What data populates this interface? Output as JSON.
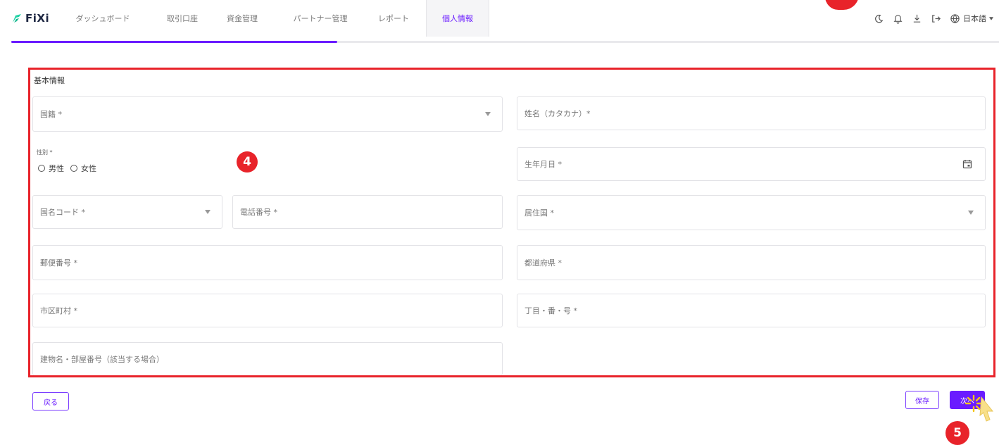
{
  "app": {
    "logo_text": "FiXi"
  },
  "nav": {
    "tabs": [
      {
        "label": "ダッシュボード"
      },
      {
        "label": "取引口座"
      },
      {
        "label": "資金管理"
      },
      {
        "label": "パートナー管理"
      },
      {
        "label": "レポート"
      },
      {
        "label": "個人情報",
        "active": true
      }
    ]
  },
  "header_right": {
    "icons": [
      "theme-moon-icon",
      "bell-icon",
      "download-icon",
      "logout-icon",
      "globe-icon"
    ],
    "language": "日本語"
  },
  "progress": {
    "fraction": 0.33
  },
  "form": {
    "section_title": "基本情報",
    "fields": {
      "nationality": "国籍 *",
      "name_kana": "姓名（カタカナ）*",
      "gender_label": "性別 *",
      "gender_male": "男性",
      "gender_female": "女性",
      "birthdate": "生年月日 *",
      "country_code": "国名コード *",
      "phone": "電話番号 *",
      "residence_country": "居住国 *",
      "postal_code": "郵便番号 *",
      "prefecture": "都道府県 *",
      "city": "市区町村 *",
      "address_detail": "丁目・番・号 *",
      "building": "建物名・部屋番号（該当する場合）"
    }
  },
  "buttons": {
    "back": "戻る",
    "save": "保存",
    "next": "次へ"
  },
  "annotations": {
    "step4": "4",
    "step5": "5"
  },
  "colors": {
    "accent": "#6a1bff",
    "annotation_red": "#e8232a"
  }
}
